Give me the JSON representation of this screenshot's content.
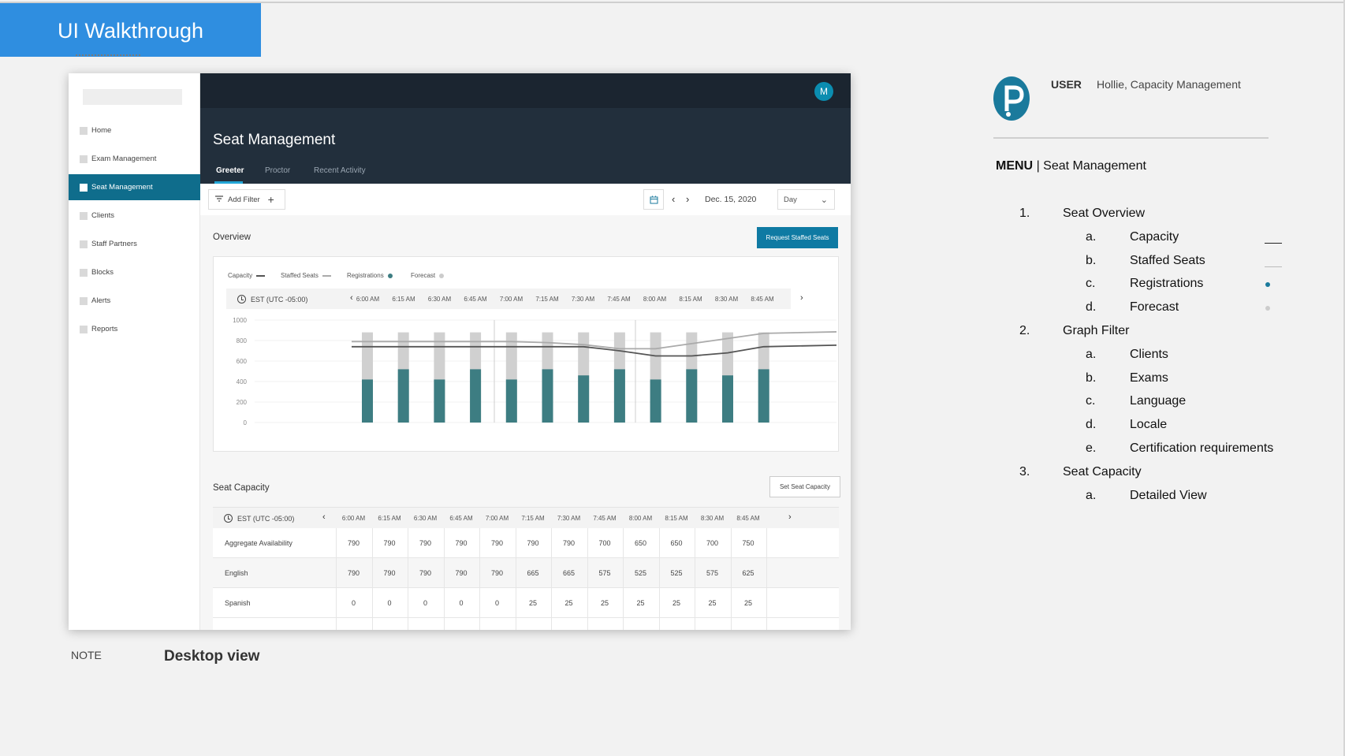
{
  "banner": {
    "title": "UI Walkthrough"
  },
  "app": {
    "avatar_initial": "M",
    "page_title": "Seat Management",
    "sidebar": [
      {
        "label": "Home",
        "active": false
      },
      {
        "label": "Exam Management",
        "active": false
      },
      {
        "label": "Seat Management",
        "active": true
      },
      {
        "label": "Clients",
        "active": false
      },
      {
        "label": "Staff Partners",
        "active": false
      },
      {
        "label": "Blocks",
        "active": false
      },
      {
        "label": "Alerts",
        "active": false
      },
      {
        "label": "Reports",
        "active": false
      }
    ],
    "tabs": [
      {
        "label": "Greeter",
        "active": true
      },
      {
        "label": "Proctor",
        "active": false
      },
      {
        "label": "Recent Activity",
        "active": false
      }
    ],
    "filter": {
      "add_filter_label": "Add Filter",
      "add_icon": "+",
      "date": "Dec. 15, 2020",
      "view_select": "Day"
    },
    "overview": {
      "title": "Overview",
      "request_button": "Request Staffed Seats",
      "legend": [
        {
          "label": "Capacity",
          "marker": "line",
          "color": "#555555"
        },
        {
          "label": "Staffed Seats",
          "marker": "line",
          "color": "#aaaaaa"
        },
        {
          "label": "Registrations",
          "marker": "dot",
          "color": "#3d7d82"
        },
        {
          "label": "Forecast",
          "marker": "dot",
          "color": "#cccccc"
        }
      ],
      "timezone": "EST (UTC -05:00)",
      "times": [
        "6:00 AM",
        "6:15 AM",
        "6:30 AM",
        "6:45 AM",
        "7:00 AM",
        "7:15 AM",
        "7:30 AM",
        "7:45 AM",
        "8:00 AM",
        "8:15 AM",
        "8:30 AM",
        "8:45 AM"
      ]
    },
    "seat_capacity": {
      "title": "Seat Capacity",
      "set_button": "Set Seat Capacity",
      "timezone": "EST (UTC -05:00)",
      "times": [
        "6:00 AM",
        "6:15 AM",
        "6:30 AM",
        "6:45 AM",
        "7:00 AM",
        "7:15 AM",
        "7:30 AM",
        "7:45 AM",
        "8:00 AM",
        "8:15 AM",
        "8:30 AM",
        "8:45 AM"
      ],
      "rows": [
        {
          "label": "Aggregate Availability",
          "values": [
            "790",
            "790",
            "790",
            "790",
            "790",
            "790",
            "790",
            "700",
            "650",
            "650",
            "700",
            "750"
          ]
        },
        {
          "label": "English",
          "values": [
            "790",
            "790",
            "790",
            "790",
            "790",
            "665",
            "665",
            "575",
            "525",
            "525",
            "575",
            "625"
          ]
        },
        {
          "label": "Spanish",
          "values": [
            "0",
            "0",
            "0",
            "0",
            "0",
            "25",
            "25",
            "25",
            "25",
            "25",
            "25",
            "25"
          ]
        }
      ]
    }
  },
  "chart_data": {
    "type": "bar",
    "categories": [
      "6:00 AM",
      "6:15 AM",
      "6:30 AM",
      "6:45 AM",
      "7:00 AM",
      "7:15 AM",
      "7:30 AM",
      "7:45 AM",
      "8:00 AM",
      "8:15 AM",
      "8:30 AM",
      "8:45 AM"
    ],
    "yticks": [
      "1000",
      "800",
      "600",
      "400",
      "200",
      "0"
    ],
    "ylim": [
      0,
      1000
    ],
    "series": [
      {
        "name": "Registrations",
        "kind": "bar",
        "color": "#3d7d82",
        "values": [
          420,
          520,
          420,
          520,
          420,
          520,
          460,
          520,
          420,
          520,
          460,
          520
        ]
      },
      {
        "name": "Forecast",
        "kind": "bar",
        "color": "#d0d0d0",
        "values": [
          880,
          880,
          880,
          880,
          880,
          880,
          880,
          880,
          880,
          880,
          880,
          880
        ]
      },
      {
        "name": "Capacity",
        "kind": "line",
        "color": "#555555",
        "values": [
          740,
          740,
          740,
          740,
          740,
          740,
          740,
          700,
          650,
          650,
          680,
          740
        ]
      },
      {
        "name": "Staffed Seats",
        "kind": "line",
        "color": "#aaaaaa",
        "values": [
          790,
          790,
          790,
          790,
          790,
          780,
          760,
          720,
          720,
          770,
          820,
          870
        ]
      }
    ]
  },
  "panel": {
    "user_label": "USER",
    "user_value": "Hollie, Capacity Management",
    "menu_label": "MENU",
    "menu_sep": "|",
    "menu_value": "Seat Management",
    "items": [
      {
        "num": "1.",
        "text": "Seat Overview",
        "level": 0
      },
      {
        "num": "a.",
        "text": "Capacity",
        "level": 1,
        "marker": "line",
        "color": "#222222"
      },
      {
        "num": "b.",
        "text": "Staffed Seats",
        "level": 1,
        "marker": "line",
        "color": "#bbbbbb"
      },
      {
        "num": "c.",
        "text": "Registrations",
        "level": 1,
        "marker": "dot",
        "color": "#1a7a9c"
      },
      {
        "num": "d.",
        "text": "Forecast",
        "level": 1,
        "marker": "dot",
        "color": "#cccccc"
      },
      {
        "num": "2.",
        "text": "Graph Filter",
        "level": 0
      },
      {
        "num": "a.",
        "text": "Clients",
        "level": 1
      },
      {
        "num": "b.",
        "text": "Exams",
        "level": 1
      },
      {
        "num": "c.",
        "text": "Language",
        "level": 1
      },
      {
        "num": "d.",
        "text": "Locale",
        "level": 1
      },
      {
        "num": "e.",
        "text": "Certification requirements",
        "level": 1
      },
      {
        "num": "3.",
        "text": "Seat Capacity",
        "level": 0
      },
      {
        "num": "a.",
        "text": "Detailed View",
        "level": 1
      }
    ]
  },
  "note": {
    "label": "NOTE",
    "value": "Desktop view"
  }
}
